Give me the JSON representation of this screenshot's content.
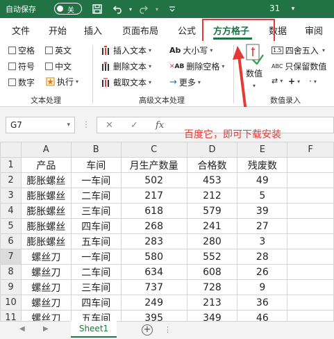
{
  "titlebar": {
    "autosave_label": "自动保存",
    "toggle_label": "关",
    "doc_title": "31",
    "bg_color": "#217346"
  },
  "tabs": [
    {
      "label": "文件"
    },
    {
      "label": "开始"
    },
    {
      "label": "插入"
    },
    {
      "label": "页面布局"
    },
    {
      "label": "公式"
    },
    {
      "label": "方方格子"
    },
    {
      "label": "数据"
    },
    {
      "label": "审阅"
    }
  ],
  "ribbon": {
    "text_group": {
      "label": "文本处理",
      "checks": [
        "空格",
        "英文",
        "符号",
        "中文",
        "数字"
      ],
      "execute": "执行"
    },
    "adv_group": {
      "label": "高级文本处理",
      "insert_text": "插入文本",
      "delete_text": "删除文本",
      "extract_text": "截取文本",
      "case": "大小写",
      "delete_space": "删除空格",
      "more": "更多"
    },
    "num_group": {
      "label": "数值录入",
      "value_btn": "数值",
      "round": "四舍五入",
      "keep_value": "只保留数值",
      "round_icon_text": "1.5",
      "keep_icon_text": "ABC"
    }
  },
  "formula_bar": {
    "name_box": "G7",
    "fx": "fx"
  },
  "annotation": "百度它，即可下载安装",
  "grid": {
    "col_headers": [
      "A",
      "B",
      "C",
      "D",
      "E",
      "F"
    ],
    "rows": [
      [
        "产品",
        "车间",
        "月生产数量",
        "合格数",
        "残废数",
        ""
      ],
      [
        "膨胀螺丝",
        "一车间",
        "502",
        "453",
        "49",
        ""
      ],
      [
        "膨胀螺丝",
        "二车间",
        "217",
        "212",
        "5",
        ""
      ],
      [
        "膨胀螺丝",
        "三车间",
        "618",
        "579",
        "39",
        ""
      ],
      [
        "膨胀螺丝",
        "四车间",
        "268",
        "241",
        "27",
        ""
      ],
      [
        "膨胀螺丝",
        "五车间",
        "283",
        "280",
        "3",
        ""
      ],
      [
        "螺丝刀",
        "一车间",
        "580",
        "552",
        "28",
        ""
      ],
      [
        "螺丝刀",
        "二车间",
        "634",
        "608",
        "26",
        ""
      ],
      [
        "螺丝刀",
        "三车间",
        "737",
        "728",
        "9",
        ""
      ],
      [
        "螺丝刀",
        "四车间",
        "249",
        "213",
        "36",
        ""
      ],
      [
        "螺丝刀",
        "五车间",
        "395",
        "349",
        "46",
        ""
      ]
    ]
  },
  "sheets": [
    {
      "label": "Sheet1"
    }
  ],
  "colors": {
    "accent": "#217346",
    "annotation": "#e53935"
  }
}
